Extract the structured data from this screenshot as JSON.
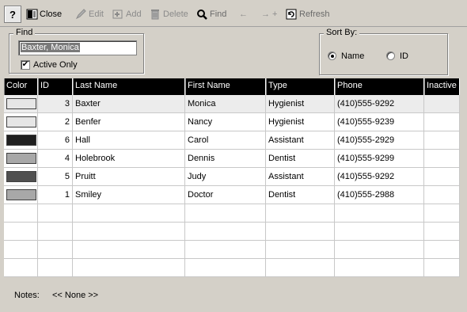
{
  "toolbar": {
    "help": "?",
    "close": "Close",
    "edit": "Edit",
    "add": "Add",
    "delete": "Delete",
    "find": "Find",
    "prev": "←",
    "next": "→ +",
    "refresh": "Refresh"
  },
  "find": {
    "title": "Find",
    "value": "Baxter, Monica",
    "active_only_label": "Active Only",
    "active_only_checked": true
  },
  "sort": {
    "title": "Sort By:",
    "options": [
      "Name",
      "ID"
    ],
    "selected": "Name"
  },
  "grid": {
    "columns": [
      "Color",
      "ID",
      "Last Name",
      "First Name",
      "Type",
      "Phone",
      "Inactive"
    ],
    "rows": [
      {
        "color": "#e6e6e6",
        "id": "3",
        "last": "Baxter",
        "first": "Monica",
        "type": "Hygienist",
        "phone": "(410)555-9292",
        "inactive": ""
      },
      {
        "color": "#e6e6e6",
        "id": "2",
        "last": "Benfer",
        "first": "Nancy",
        "type": "Hygienist",
        "phone": "(410)555-9239",
        "inactive": ""
      },
      {
        "color": "#202020",
        "id": "6",
        "last": "Hall",
        "first": "Carol",
        "type": "Assistant",
        "phone": "(410)555-2929",
        "inactive": ""
      },
      {
        "color": "#a8a8a8",
        "id": "4",
        "last": "Holebrook",
        "first": "Dennis",
        "type": "Dentist",
        "phone": "(410)555-9299",
        "inactive": ""
      },
      {
        "color": "#505050",
        "id": "5",
        "last": "Pruitt",
        "first": "Judy",
        "type": "Assistant",
        "phone": "(410)555-9292",
        "inactive": ""
      },
      {
        "color": "#a8a8a8",
        "id": "1",
        "last": "Smiley",
        "first": "Doctor",
        "type": "Dentist",
        "phone": "(410)555-2988",
        "inactive": ""
      }
    ]
  },
  "notes": {
    "label": "Notes:",
    "value": "<< None >>"
  }
}
